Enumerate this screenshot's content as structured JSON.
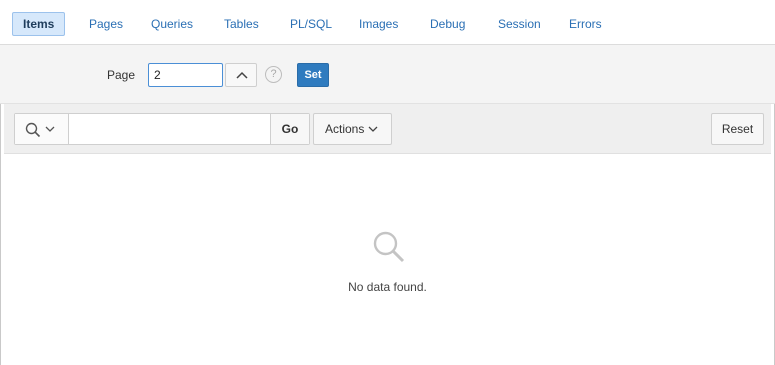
{
  "tabs": [
    {
      "label": "Items",
      "active": true
    },
    {
      "label": "Pages"
    },
    {
      "label": "Queries"
    },
    {
      "label": "Tables"
    },
    {
      "label": "PL/SQL"
    },
    {
      "label": "Images"
    },
    {
      "label": "Debug"
    },
    {
      "label": "Session"
    },
    {
      "label": "Errors"
    }
  ],
  "page_setter": {
    "label": "Page",
    "value": "2",
    "up_icon": "chevron-up-icon",
    "help_icon": "question-circle-icon",
    "help_glyph": "?",
    "set_label": "Set"
  },
  "toolbar": {
    "search_icon": "search-icon",
    "search_value": "",
    "go_label": "Go",
    "actions_label": "Actions",
    "reset_label": "Reset"
  },
  "empty_state": {
    "icon": "search-icon",
    "message": "No data found."
  },
  "colors": {
    "tab_text": "#2a6fb4",
    "tab_active_bg": "#d6e8fb",
    "set_button": "#2f7bbf",
    "input_border": "#4b8fd6"
  }
}
